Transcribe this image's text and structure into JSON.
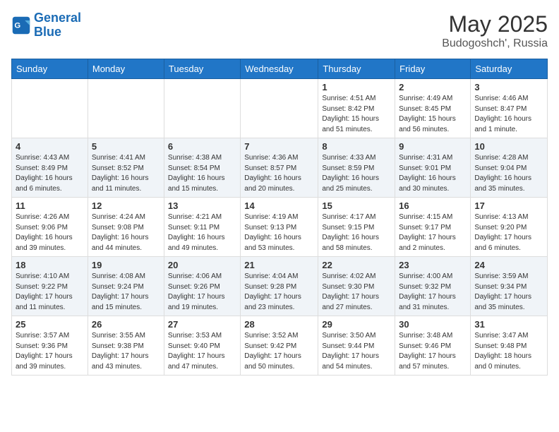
{
  "header": {
    "logo_line1": "General",
    "logo_line2": "Blue",
    "title": "May 2025",
    "location": "Budogoshch', Russia"
  },
  "days_of_week": [
    "Sunday",
    "Monday",
    "Tuesday",
    "Wednesday",
    "Thursday",
    "Friday",
    "Saturday"
  ],
  "weeks": [
    [
      {
        "num": "",
        "info": ""
      },
      {
        "num": "",
        "info": ""
      },
      {
        "num": "",
        "info": ""
      },
      {
        "num": "",
        "info": ""
      },
      {
        "num": "1",
        "info": "Sunrise: 4:51 AM\nSunset: 8:42 PM\nDaylight: 15 hours\nand 51 minutes."
      },
      {
        "num": "2",
        "info": "Sunrise: 4:49 AM\nSunset: 8:45 PM\nDaylight: 15 hours\nand 56 minutes."
      },
      {
        "num": "3",
        "info": "Sunrise: 4:46 AM\nSunset: 8:47 PM\nDaylight: 16 hours\nand 1 minute."
      }
    ],
    [
      {
        "num": "4",
        "info": "Sunrise: 4:43 AM\nSunset: 8:49 PM\nDaylight: 16 hours\nand 6 minutes."
      },
      {
        "num": "5",
        "info": "Sunrise: 4:41 AM\nSunset: 8:52 PM\nDaylight: 16 hours\nand 11 minutes."
      },
      {
        "num": "6",
        "info": "Sunrise: 4:38 AM\nSunset: 8:54 PM\nDaylight: 16 hours\nand 15 minutes."
      },
      {
        "num": "7",
        "info": "Sunrise: 4:36 AM\nSunset: 8:57 PM\nDaylight: 16 hours\nand 20 minutes."
      },
      {
        "num": "8",
        "info": "Sunrise: 4:33 AM\nSunset: 8:59 PM\nDaylight: 16 hours\nand 25 minutes."
      },
      {
        "num": "9",
        "info": "Sunrise: 4:31 AM\nSunset: 9:01 PM\nDaylight: 16 hours\nand 30 minutes."
      },
      {
        "num": "10",
        "info": "Sunrise: 4:28 AM\nSunset: 9:04 PM\nDaylight: 16 hours\nand 35 minutes."
      }
    ],
    [
      {
        "num": "11",
        "info": "Sunrise: 4:26 AM\nSunset: 9:06 PM\nDaylight: 16 hours\nand 39 minutes."
      },
      {
        "num": "12",
        "info": "Sunrise: 4:24 AM\nSunset: 9:08 PM\nDaylight: 16 hours\nand 44 minutes."
      },
      {
        "num": "13",
        "info": "Sunrise: 4:21 AM\nSunset: 9:11 PM\nDaylight: 16 hours\nand 49 minutes."
      },
      {
        "num": "14",
        "info": "Sunrise: 4:19 AM\nSunset: 9:13 PM\nDaylight: 16 hours\nand 53 minutes."
      },
      {
        "num": "15",
        "info": "Sunrise: 4:17 AM\nSunset: 9:15 PM\nDaylight: 16 hours\nand 58 minutes."
      },
      {
        "num": "16",
        "info": "Sunrise: 4:15 AM\nSunset: 9:17 PM\nDaylight: 17 hours\nand 2 minutes."
      },
      {
        "num": "17",
        "info": "Sunrise: 4:13 AM\nSunset: 9:20 PM\nDaylight: 17 hours\nand 6 minutes."
      }
    ],
    [
      {
        "num": "18",
        "info": "Sunrise: 4:10 AM\nSunset: 9:22 PM\nDaylight: 17 hours\nand 11 minutes."
      },
      {
        "num": "19",
        "info": "Sunrise: 4:08 AM\nSunset: 9:24 PM\nDaylight: 17 hours\nand 15 minutes."
      },
      {
        "num": "20",
        "info": "Sunrise: 4:06 AM\nSunset: 9:26 PM\nDaylight: 17 hours\nand 19 minutes."
      },
      {
        "num": "21",
        "info": "Sunrise: 4:04 AM\nSunset: 9:28 PM\nDaylight: 17 hours\nand 23 minutes."
      },
      {
        "num": "22",
        "info": "Sunrise: 4:02 AM\nSunset: 9:30 PM\nDaylight: 17 hours\nand 27 minutes."
      },
      {
        "num": "23",
        "info": "Sunrise: 4:00 AM\nSunset: 9:32 PM\nDaylight: 17 hours\nand 31 minutes."
      },
      {
        "num": "24",
        "info": "Sunrise: 3:59 AM\nSunset: 9:34 PM\nDaylight: 17 hours\nand 35 minutes."
      }
    ],
    [
      {
        "num": "25",
        "info": "Sunrise: 3:57 AM\nSunset: 9:36 PM\nDaylight: 17 hours\nand 39 minutes."
      },
      {
        "num": "26",
        "info": "Sunrise: 3:55 AM\nSunset: 9:38 PM\nDaylight: 17 hours\nand 43 minutes."
      },
      {
        "num": "27",
        "info": "Sunrise: 3:53 AM\nSunset: 9:40 PM\nDaylight: 17 hours\nand 47 minutes."
      },
      {
        "num": "28",
        "info": "Sunrise: 3:52 AM\nSunset: 9:42 PM\nDaylight: 17 hours\nand 50 minutes."
      },
      {
        "num": "29",
        "info": "Sunrise: 3:50 AM\nSunset: 9:44 PM\nDaylight: 17 hours\nand 54 minutes."
      },
      {
        "num": "30",
        "info": "Sunrise: 3:48 AM\nSunset: 9:46 PM\nDaylight: 17 hours\nand 57 minutes."
      },
      {
        "num": "31",
        "info": "Sunrise: 3:47 AM\nSunset: 9:48 PM\nDaylight: 18 hours\nand 0 minutes."
      }
    ]
  ]
}
